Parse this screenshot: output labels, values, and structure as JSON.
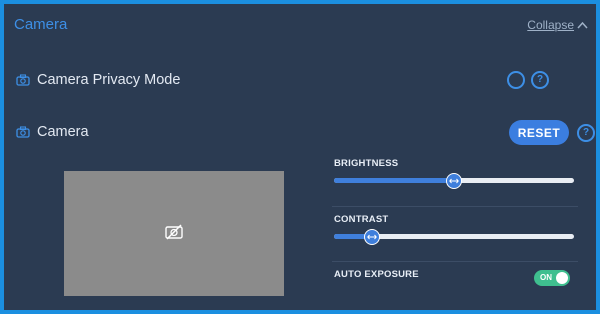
{
  "section": {
    "title": "Camera",
    "collapse_label": "Collapse"
  },
  "privacy": {
    "label": "Camera Privacy Mode",
    "enabled": false
  },
  "camera": {
    "label": "Camera",
    "reset_label": "RESET"
  },
  "controls": {
    "brightness": {
      "label": "BRIGHTNESS",
      "value_percent": 50
    },
    "contrast": {
      "label": "CONTRAST",
      "value_percent": 16
    },
    "auto_exposure": {
      "label": "AUTO EXPOSURE",
      "state_label": "ON",
      "enabled": true
    }
  },
  "help_label": "?",
  "colors": {
    "accent": "#3d8fe6",
    "panel_bg": "#2b3b52",
    "toggle_on": "#3fbf8f",
    "preview_bg": "#8b8b8b"
  }
}
